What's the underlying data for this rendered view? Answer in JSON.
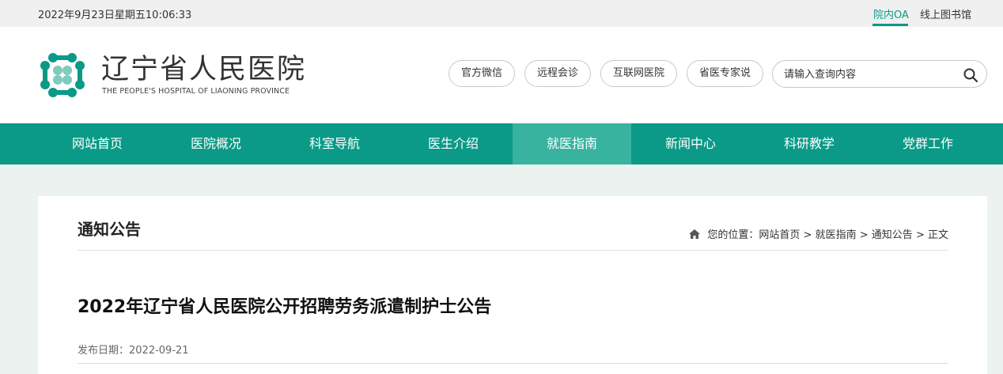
{
  "topbar": {
    "datetime": "2022年9月23日星期五10:06:33",
    "links": [
      "院内OA",
      "线上图书馆"
    ]
  },
  "header": {
    "logo_cn": "辽宁省人民医院",
    "logo_en": "THE PEOPLE'S HOSPITAL OF LIAONING PROVINCE",
    "quick_links": [
      "官方微信",
      "远程会诊",
      "互联网医院",
      "省医专家说"
    ],
    "search": {
      "placeholder": "请输入查询内容",
      "icon": "search-icon"
    }
  },
  "nav": {
    "items": [
      "网站首页",
      "医院概况",
      "科室导航",
      "医生介绍",
      "就医指南",
      "新闻中心",
      "科研教学",
      "党群工作"
    ],
    "active": "就医指南"
  },
  "section": {
    "title": "通知公告",
    "breadcrumb": {
      "prefix": "您的位置：",
      "items": [
        "网站首页",
        "就医指南",
        "通知公告",
        "正文"
      ],
      "separator": ">"
    }
  },
  "article": {
    "title": "2022年辽宁省人民医院公开招聘劳务派遣制护士公告",
    "date_label": "发布日期：",
    "date": "2022-09-21"
  },
  "colors": {
    "brand": "#0a9a87",
    "nav_active": "#37b39f",
    "page_bg": "#ecf2ef"
  }
}
